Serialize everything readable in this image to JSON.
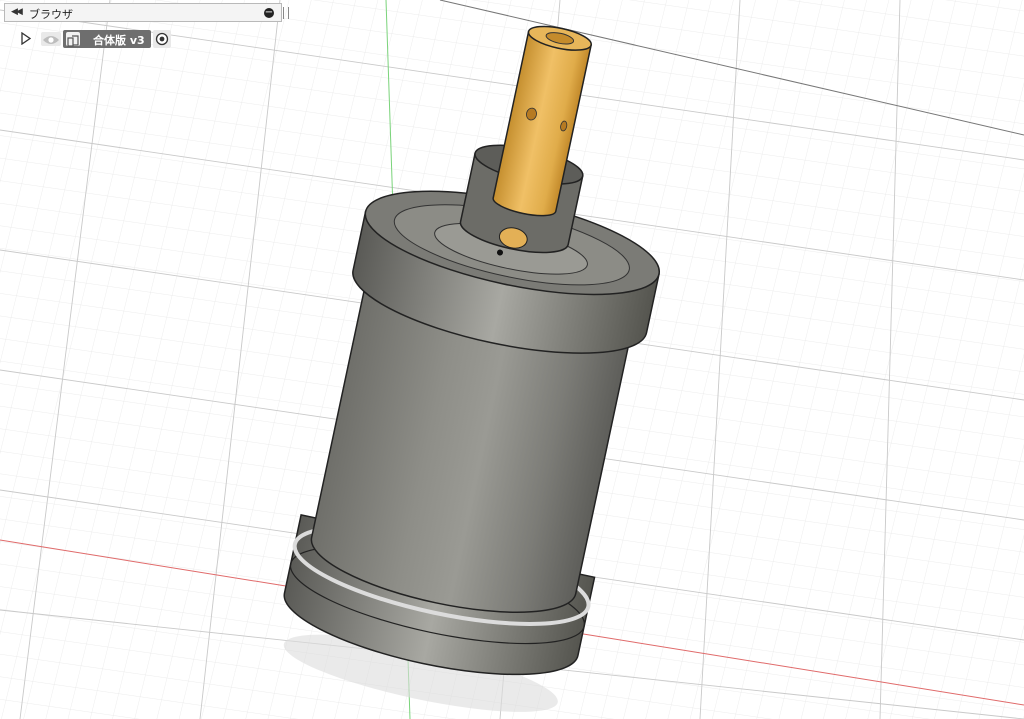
{
  "browser": {
    "title": "ブラウザ",
    "collapse_icon": "double-chevron-left-icon",
    "options_icon": "minus-circle-icon",
    "root_component": {
      "label": "合体版 v3",
      "expand_icon": "triangle-right-icon",
      "visibility_icon": "eye-icon",
      "type_icon": "component-icon",
      "activate_icon": "radio-active-icon"
    }
  },
  "viewport": {
    "model_colors": {
      "body": "#8a8a84",
      "brass": "#e0ac4a"
    },
    "grid_color": "#d9d9d9",
    "axis_colors": {
      "x": "#e06a6a",
      "y": "#7ad37a"
    }
  }
}
